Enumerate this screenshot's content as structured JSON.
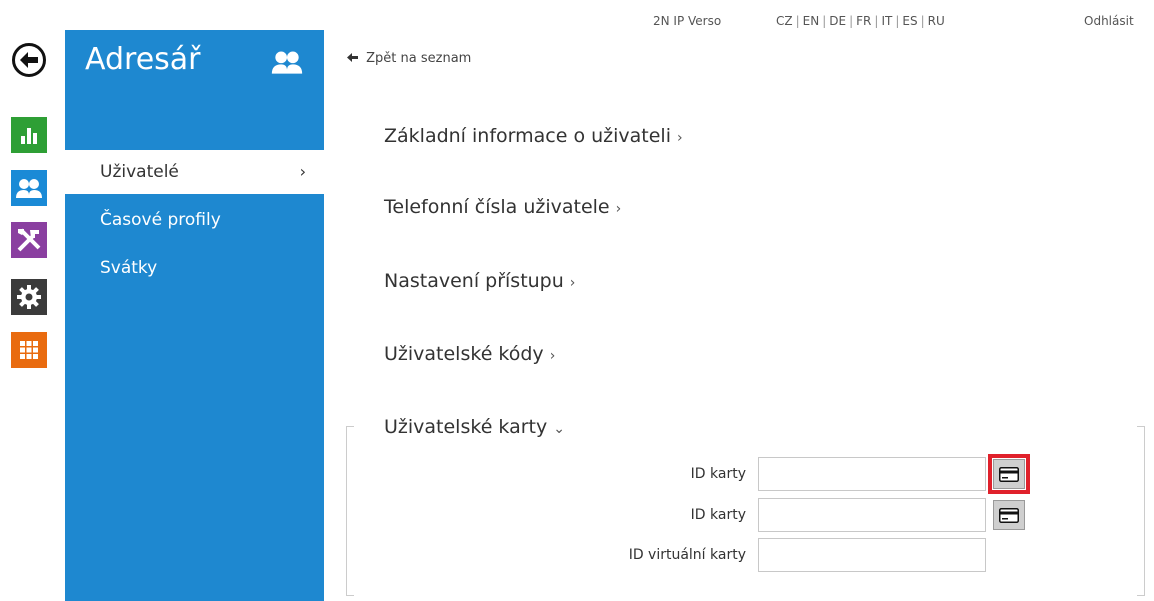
{
  "topbar": {
    "device_name": "2N IP Verso",
    "languages": [
      "CZ",
      "EN",
      "DE",
      "FR",
      "IT",
      "ES",
      "RU"
    ],
    "logout_label": "Odhlásit"
  },
  "rail": {
    "icons": [
      "stats-icon",
      "users-icon",
      "tools-icon",
      "gear-icon",
      "grid-icon"
    ],
    "colors": {
      "stats": "#2e9f35",
      "users": "#1a8ad6",
      "tools": "#8a3fa0",
      "gear": "#3b3b3b",
      "grid": "#e96b0f"
    }
  },
  "sidebar": {
    "title": "Adresář",
    "accent": "#1e88d0",
    "items": [
      {
        "label": "Uživatelé",
        "active": true
      },
      {
        "label": "Časové profily",
        "active": false
      },
      {
        "label": "Svátky",
        "active": false
      }
    ]
  },
  "main": {
    "back_link": "Zpět na seznam",
    "sections": [
      {
        "label": "Základní informace o uživateli",
        "expanded": false
      },
      {
        "label": "Telefonní čísla uživatele",
        "expanded": false
      },
      {
        "label": "Nastavení přístupu",
        "expanded": false
      },
      {
        "label": "Uživatelské kódy",
        "expanded": false
      },
      {
        "label": "Uživatelské karty",
        "expanded": true
      }
    ],
    "fields": [
      {
        "label": "ID karty",
        "value": ""
      },
      {
        "label": "ID karty",
        "value": ""
      },
      {
        "label": "ID virtuální karty",
        "value": ""
      }
    ],
    "highlight_color": "#e0212b"
  }
}
